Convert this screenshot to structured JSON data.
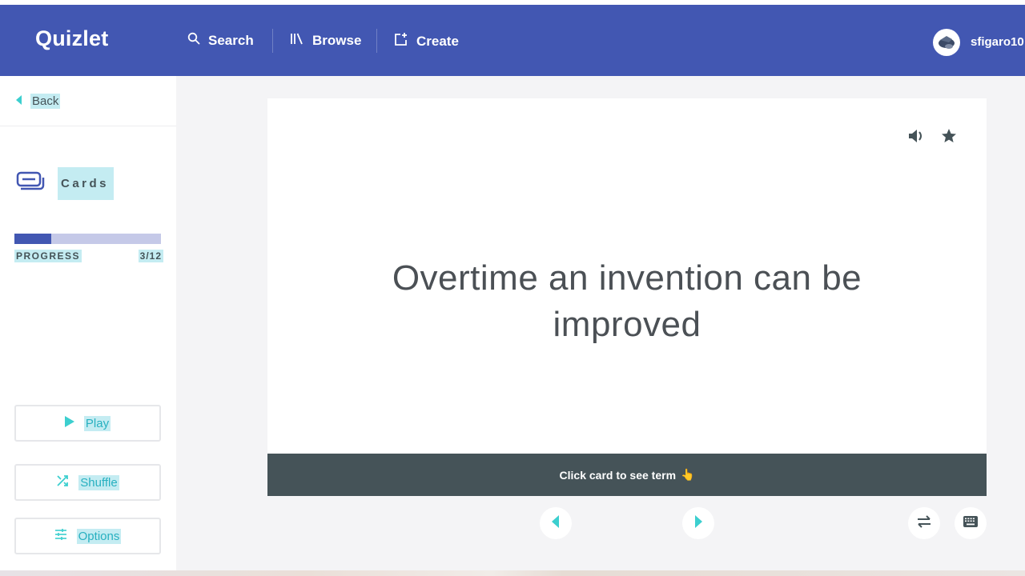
{
  "header": {
    "logo": "Quizlet",
    "nav": [
      {
        "label": "Search",
        "icon": "search-icon"
      },
      {
        "label": "Browse",
        "icon": "library-icon"
      },
      {
        "label": "Create",
        "icon": "create-icon"
      }
    ],
    "username": "sfigaro10"
  },
  "sidebar": {
    "back_label": "Back",
    "mode_label": "Cards",
    "progress": {
      "label": "PROGRESS",
      "current": 3,
      "total": 12,
      "text": "3/12",
      "fraction": 0.25
    },
    "buttons": [
      {
        "label": "Play",
        "icon": "play-icon"
      },
      {
        "label": "Shuffle",
        "icon": "shuffle-icon"
      },
      {
        "label": "Options",
        "icon": "options-icon"
      }
    ]
  },
  "card": {
    "text": "Overtime an invention can be improved",
    "footer_text": "Click card to see term",
    "footer_emoji": "👆"
  },
  "colors": {
    "brand": "#4257b2",
    "accent": "#3ccfcf",
    "dark": "#455358"
  }
}
